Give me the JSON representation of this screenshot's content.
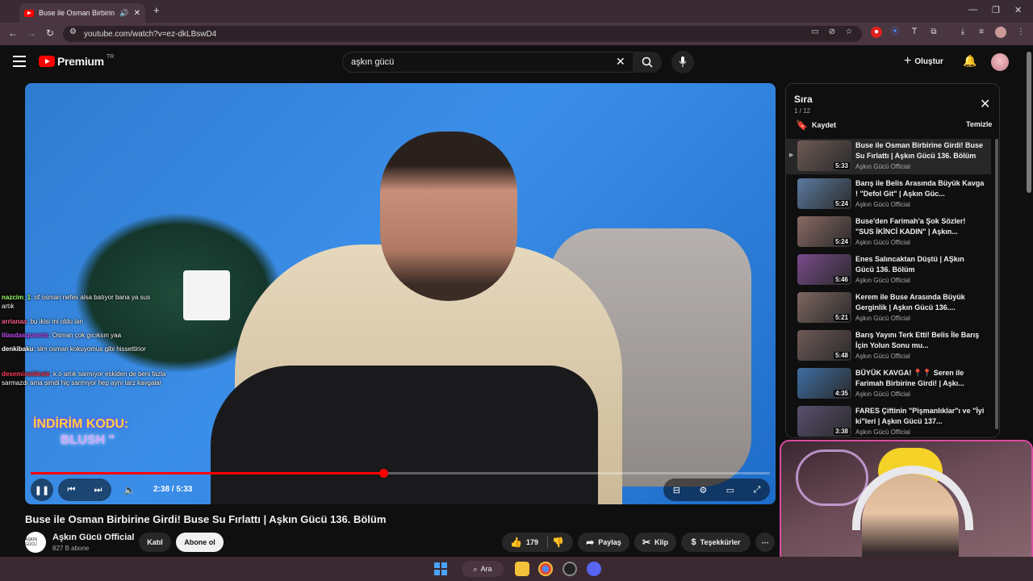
{
  "browser": {
    "tab_title": "Buse ile Osman Birbirine Girdi",
    "url": "youtube.com/watch?v=ez-dkLBswD4"
  },
  "header": {
    "logo_text": "Premium",
    "logo_region": "TR",
    "search_value": "aşkın gücü",
    "create_label": "Oluştur"
  },
  "video": {
    "title": "Buse ile Osman Birbirine Girdi! Buse Su Fırlattı | Aşkın Gücü 136. Bölüm",
    "time": "2:38 / 5:33",
    "progress_fraction": 0.477,
    "promo_line1": "İNDİRİM KODU:",
    "promo_line2": "BLUSH \"",
    "chat": [
      {
        "user": "nazcim_1",
        "text": ": of osman nefes alsa batıyor bana ya sus artık",
        "color": "#9cff6b"
      },
      {
        "user": "arrianaa",
        "text": ": bu ikisi mi oldu lan",
        "color": "#ff5c8a"
      },
      {
        "user": "lilasdasquesrts",
        "text": ": Osman çok gıcıksın yaa",
        "color": "#c44cff"
      },
      {
        "user": "denkibaku",
        "text": ": slm osman kokuyomus gibi hissettirior",
        "color": "#ffffff"
      },
      {
        "user": "desemisoidesie",
        "text": ": k.o artık sarmıyor eskiden de beni fazla sarmazdı ama şimdi hiç sarmıyor hep aynı tarz kavgalar",
        "color": "#ff3b5c"
      }
    ]
  },
  "channel": {
    "name": "Aşkın Gücü Official",
    "subs": "827 B abone",
    "avatar_text": "AŞKIN GÜCÜ",
    "join_label": "Katıl",
    "subscribe_label": "Abone ol"
  },
  "actions": {
    "likes": "179",
    "share": "Paylaş",
    "clip": "Klip",
    "thanks": "Teşekkürler"
  },
  "playlist": {
    "title": "Sıra",
    "count": "1 / 12",
    "save_label": "Kaydet",
    "clear_label": "Temizle",
    "items": [
      {
        "title": "Buse ile Osman Birbirine Girdi! Buse Su Fırlattı | Aşkın Gücü 136. Bölüm",
        "channel": "Aşkın Gücü Official",
        "duration": "5:33",
        "color": "#6e5a55"
      },
      {
        "title": "Barış ile Belis Arasında Büyük Kavga ! \"Defol Git\" | Aşkın Güc...",
        "channel": "Aşkın Gücü Official",
        "duration": "5:24",
        "color": "#5c7aa0"
      },
      {
        "title": "Buse'den Farimah'a Şok Sözler! \"SUS İKİNCİ KADIN\" | Aşkın...",
        "channel": "Aşkın Gücü Official",
        "duration": "5:24",
        "color": "#8a6a64"
      },
      {
        "title": "Enes Salıncaktan Düştü | AŞkın Gücü 136. Bölüm",
        "channel": "Aşkın Gücü Official",
        "duration": "5:46",
        "color": "#7a4a8c"
      },
      {
        "title": "Kerem ile Buse Arasında Büyük Gerginlik | Aşkın Gücü 136....",
        "channel": "Aşkın Gücü Official",
        "duration": "5:21",
        "color": "#7e6660"
      },
      {
        "title": "Barış Yayını Terk Etti! Belis İle Barış İçin Yolun Sonu mu...",
        "channel": "Aşkın Gücü Official",
        "duration": "5:48",
        "color": "#6f5a58"
      },
      {
        "title": "BÜYÜK KAVGA! 📍📍 Seren ile Farimah Birbirine Girdi! | Aşkı...",
        "channel": "Aşkın Gücü Official",
        "duration": "4:35",
        "color": "#3e6ea3"
      },
      {
        "title": "FARES Çiftinin \"Pişmanlıklar\"ı ve \"İyi ki\"leri | Aşkın Gücü 137...",
        "channel": "Aşkın Gücü Official",
        "duration": "3:38",
        "color": "#5a4f6e"
      }
    ]
  },
  "taskbar": {
    "search_label": "Ara"
  },
  "colors": {
    "accent": "#ff0000",
    "webcam_border": "#d94ba0"
  }
}
